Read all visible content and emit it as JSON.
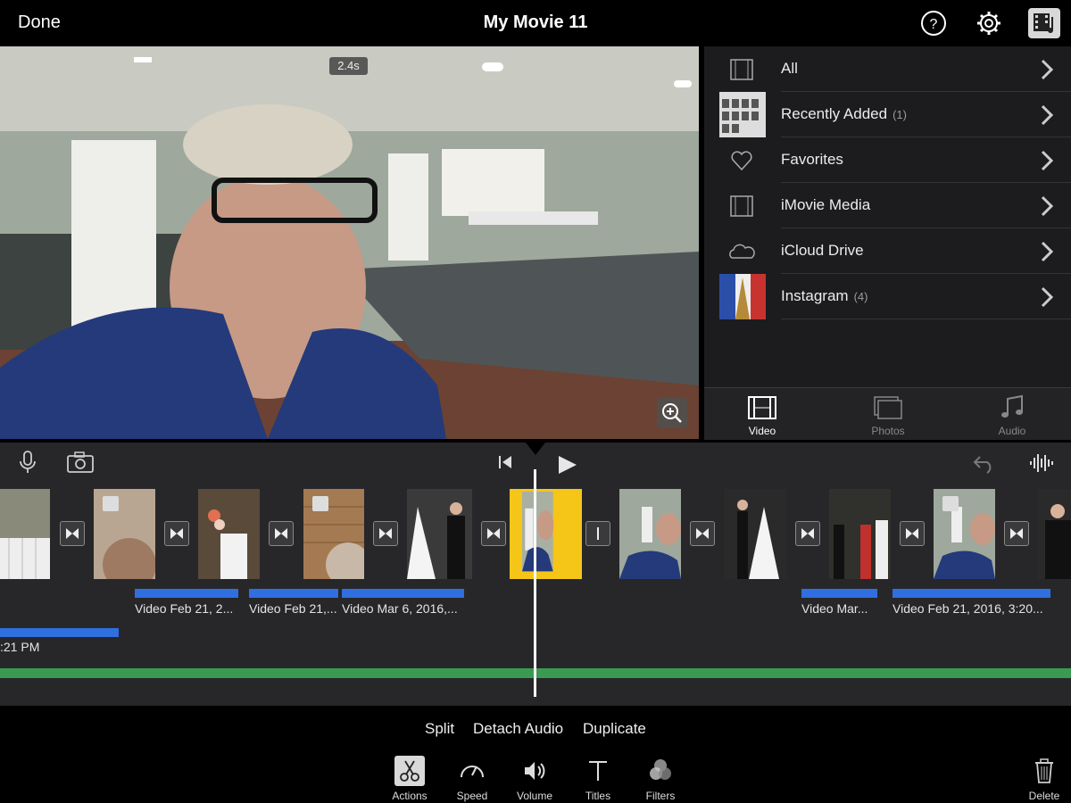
{
  "topbar": {
    "done_label": "Done",
    "title": "My Movie 11"
  },
  "viewer": {
    "time_badge": "2.4s"
  },
  "browser": {
    "items": [
      {
        "label": "All",
        "count": "",
        "icon": "film-strip-icon"
      },
      {
        "label": "Recently Added",
        "count": "(1)",
        "icon": "thumbnail"
      },
      {
        "label": "Favorites",
        "count": "",
        "icon": "heart-icon"
      },
      {
        "label": "iMovie Media",
        "count": "",
        "icon": "film-strip-icon"
      },
      {
        "label": "iCloud Drive",
        "count": "",
        "icon": "cloud-icon"
      },
      {
        "label": "Instagram",
        "count": "(4)",
        "icon": "thumbnail"
      }
    ],
    "tabs": [
      {
        "label": "Video",
        "icon": "film-icon",
        "active": true
      },
      {
        "label": "Photos",
        "icon": "photos-icon",
        "active": false
      },
      {
        "label": "Audio",
        "icon": "music-note-icon",
        "active": false
      }
    ]
  },
  "timeline": {
    "clip_labels": [
      "Video Feb 21, 2...",
      "Video Feb 21,...",
      "Video Mar 6, 2016,...",
      "Video Mar...",
      "Video Feb 21, 2016, 3:20..."
    ],
    "lower_label": ":21 PM"
  },
  "actions": [
    "Split",
    "Detach Audio",
    "Duplicate"
  ],
  "tools": [
    {
      "label": "Actions",
      "icon": "scissors-icon",
      "active": true
    },
    {
      "label": "Speed",
      "icon": "speedometer-icon",
      "active": false
    },
    {
      "label": "Volume",
      "icon": "speaker-icon",
      "active": false
    },
    {
      "label": "Titles",
      "icon": "titles-icon",
      "active": false
    },
    {
      "label": "Filters",
      "icon": "filters-icon",
      "active": false
    }
  ],
  "delete_label": "Delete",
  "colors": {
    "accent_yellow": "#f5c518",
    "audio_blue": "#2f6fe0",
    "music_green": "#3a9a52"
  }
}
